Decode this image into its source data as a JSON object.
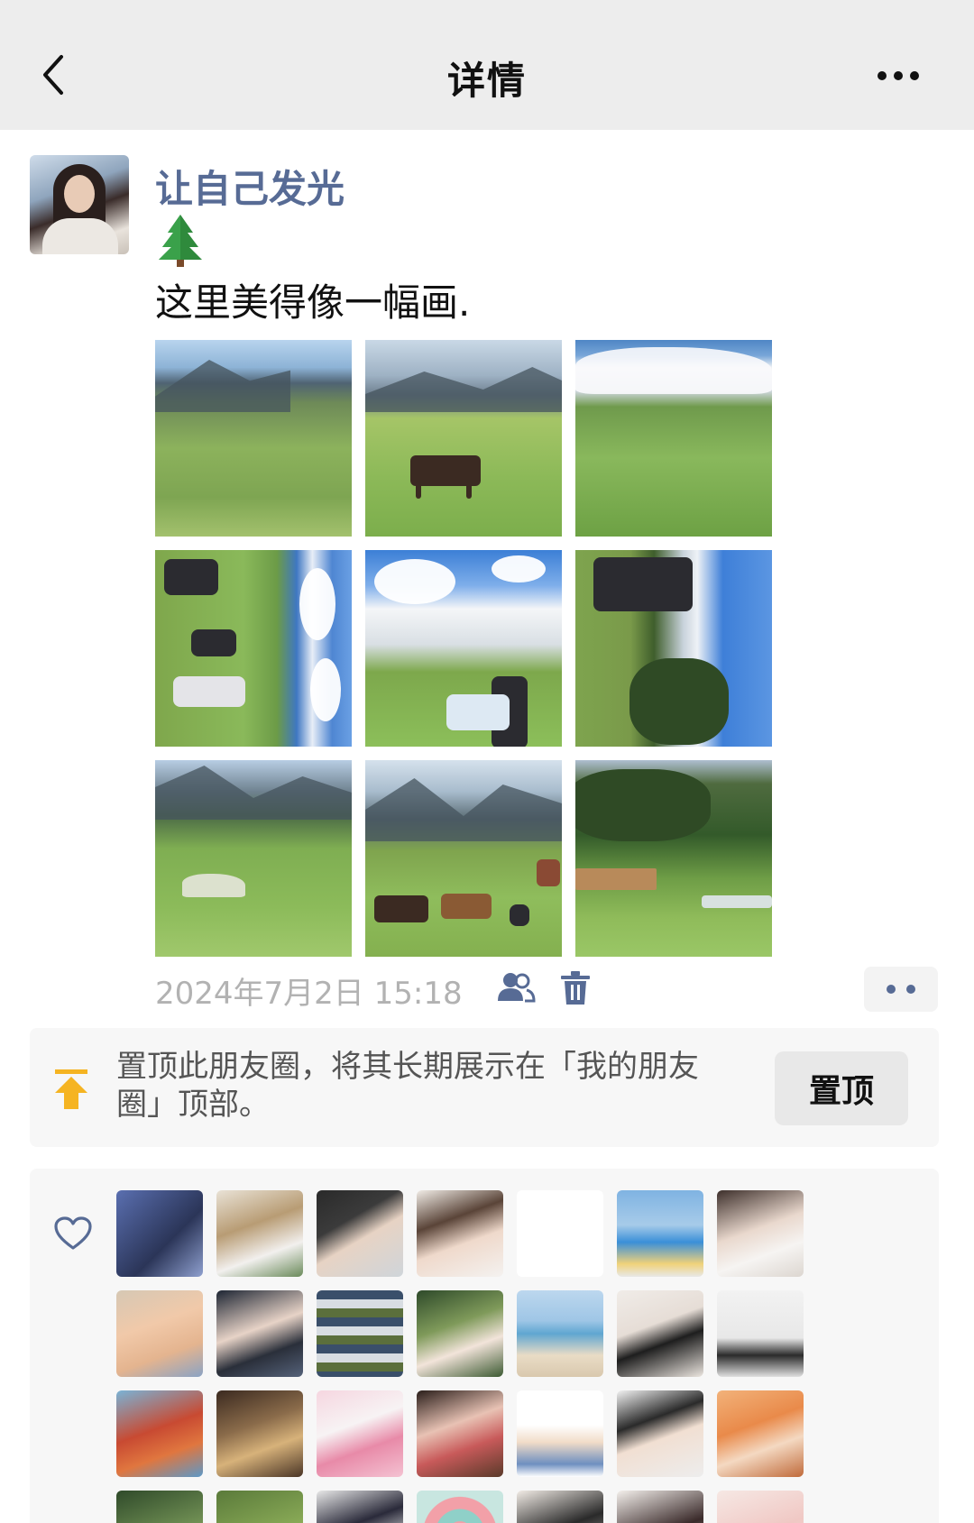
{
  "header": {
    "title": "详情"
  },
  "post": {
    "username": "让自己发光",
    "emoji": "🌲",
    "text": "这里美得像一幅画.",
    "photo_count": 9,
    "time": "2024年7月2日 15:18"
  },
  "pin": {
    "text": "置顶此朋友圈，将其长期展示在「我的朋友圈」顶部。",
    "button_label": "置顶"
  },
  "likes": {
    "avatar_count": 28
  },
  "colors": {
    "nav_bg": "#ededed",
    "username": "#576b95",
    "time": "#b2b2b2",
    "meta_icon": "#576b95",
    "pin_icon": "#f5b422",
    "panel_bg": "#f7f7f7"
  },
  "icons": {
    "back": "chevron-left-icon",
    "more": "more-icon",
    "visibility": "people-icon",
    "delete": "trash-icon",
    "pin": "pin-top-icon",
    "like": "heart-icon"
  }
}
